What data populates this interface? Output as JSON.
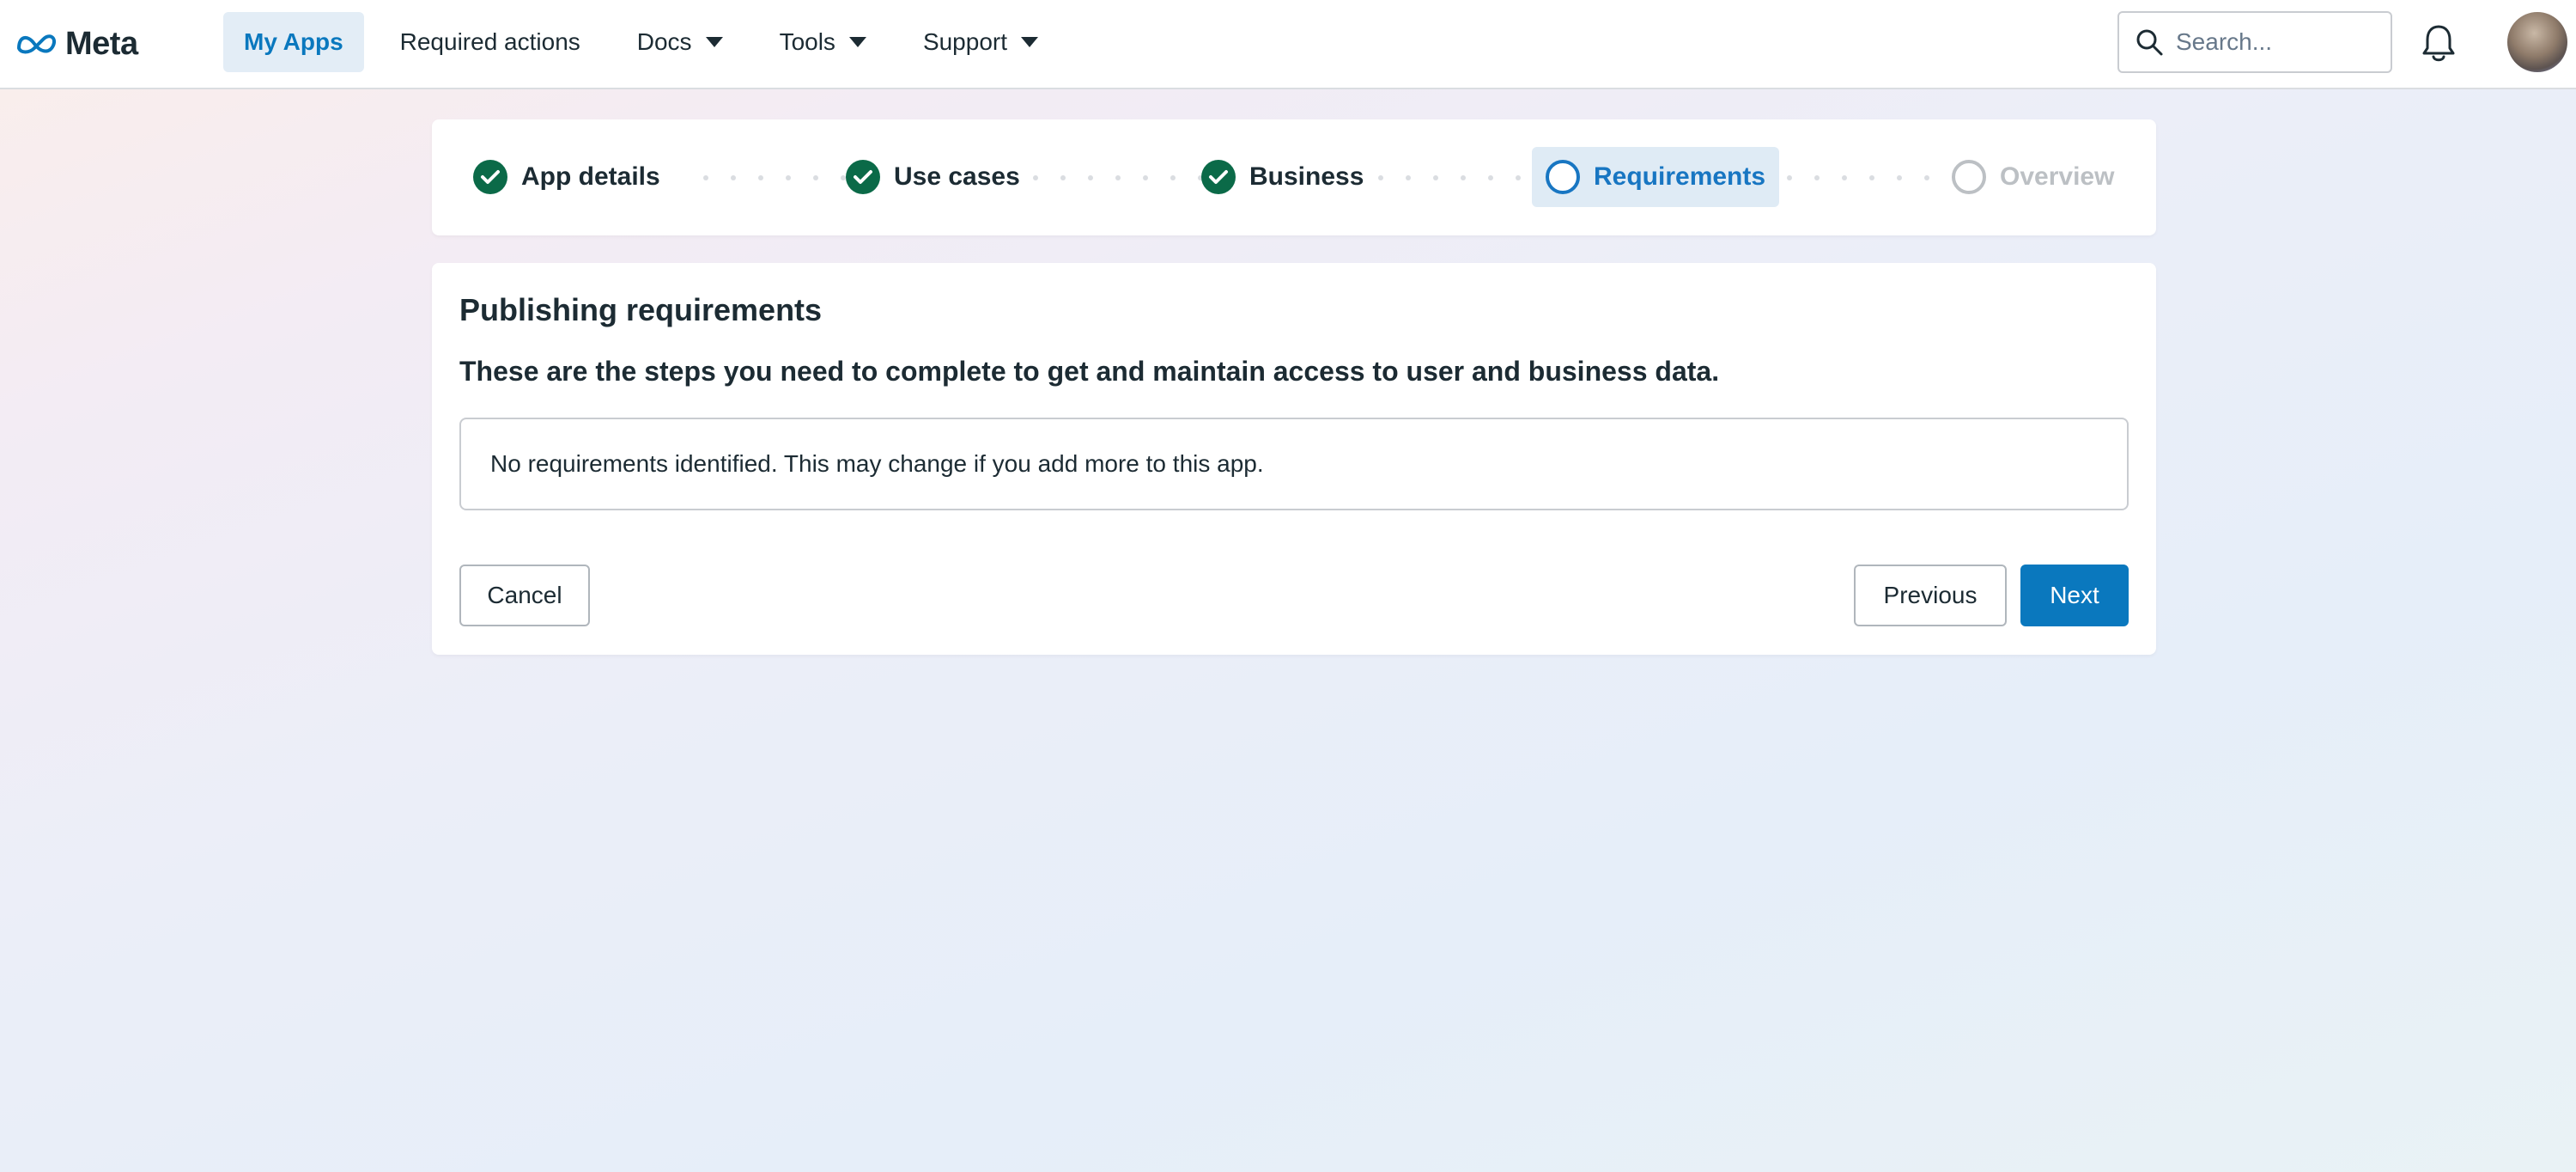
{
  "header": {
    "logo_text": "Meta",
    "nav": [
      {
        "label": "My Apps",
        "active": true,
        "has_dropdown": false
      },
      {
        "label": "Required actions",
        "active": false,
        "has_dropdown": false
      },
      {
        "label": "Docs",
        "active": false,
        "has_dropdown": true
      },
      {
        "label": "Tools",
        "active": false,
        "has_dropdown": true
      },
      {
        "label": "Support",
        "active": false,
        "has_dropdown": true
      }
    ],
    "search_placeholder": "Search...",
    "icons": {
      "search": "search-icon",
      "notifications": "bell-icon",
      "avatar": "user-avatar"
    }
  },
  "stepper": {
    "steps": [
      {
        "label": "App details",
        "state": "completed"
      },
      {
        "label": "Use cases",
        "state": "completed"
      },
      {
        "label": "Business",
        "state": "completed"
      },
      {
        "label": "Requirements",
        "state": "current"
      },
      {
        "label": "Overview",
        "state": "upcoming"
      }
    ]
  },
  "main": {
    "title": "Publishing requirements",
    "subtitle": "These are the steps you need to complete to get and maintain access to user and business data.",
    "notice": "No requirements identified. This may change if you add more to this app.",
    "buttons": {
      "cancel": "Cancel",
      "previous": "Previous",
      "next": "Next"
    }
  },
  "colors": {
    "primary": "#0a78be",
    "completed": "#0b6a48",
    "current": "#1876c2",
    "upcoming": "#bcc0c4",
    "text": "#1c2b33"
  }
}
